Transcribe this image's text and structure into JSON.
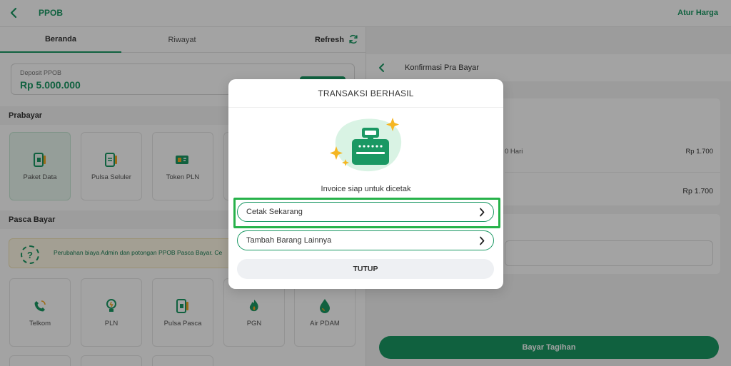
{
  "app": {
    "title": "PPOB",
    "top_right": "Atur Harga"
  },
  "tabs": [
    {
      "label": "Beranda",
      "active": true
    },
    {
      "label": "Riwayat",
      "active": false
    }
  ],
  "refresh_label": "Refresh",
  "deposit": {
    "label": "Deposit PPOB",
    "amount": "Rp 5.000.000"
  },
  "prabayar": {
    "title": "Prabayar",
    "items": [
      {
        "label": "Paket Data",
        "icon": "sim-card-icon",
        "selected": true
      },
      {
        "label": "Pulsa Seluler",
        "icon": "sim-card-icon",
        "selected": false
      },
      {
        "label": "Token PLN",
        "icon": "token-icon",
        "selected": false
      }
    ]
  },
  "pasca": {
    "title": "Pasca Bayar",
    "notice": "Perubahan biaya Admin dan potongan PPOB Pasca Bayar. Ce",
    "items": [
      {
        "label": "Telkom",
        "icon": "phone-icon"
      },
      {
        "label": "PLN",
        "icon": "bulb-icon"
      },
      {
        "label": "Pulsa Pasca",
        "icon": "sim-card-icon"
      },
      {
        "label": "PGN",
        "icon": "flame-icon"
      },
      {
        "label": "Air PDAM",
        "icon": "water-drop-icon"
      }
    ]
  },
  "right_panel": {
    "header": "Konfirmasi Pra Bayar",
    "row1_text": "0 Hari",
    "row1_price": "Rp 1.700",
    "total_price": "Rp 1.700",
    "pay_button": "Bayar Tagihan"
  },
  "modal": {
    "title": "TRANSAKSI BERHASIL",
    "message": "Invoice siap untuk dicetak",
    "option1": "Cetak Sekarang",
    "option2": "Tambah Barang Lainnya",
    "close": "TUTUP"
  },
  "colors": {
    "brand": "#1a9863",
    "accent_star": "#f5b623",
    "highlight": "#27b24a"
  }
}
